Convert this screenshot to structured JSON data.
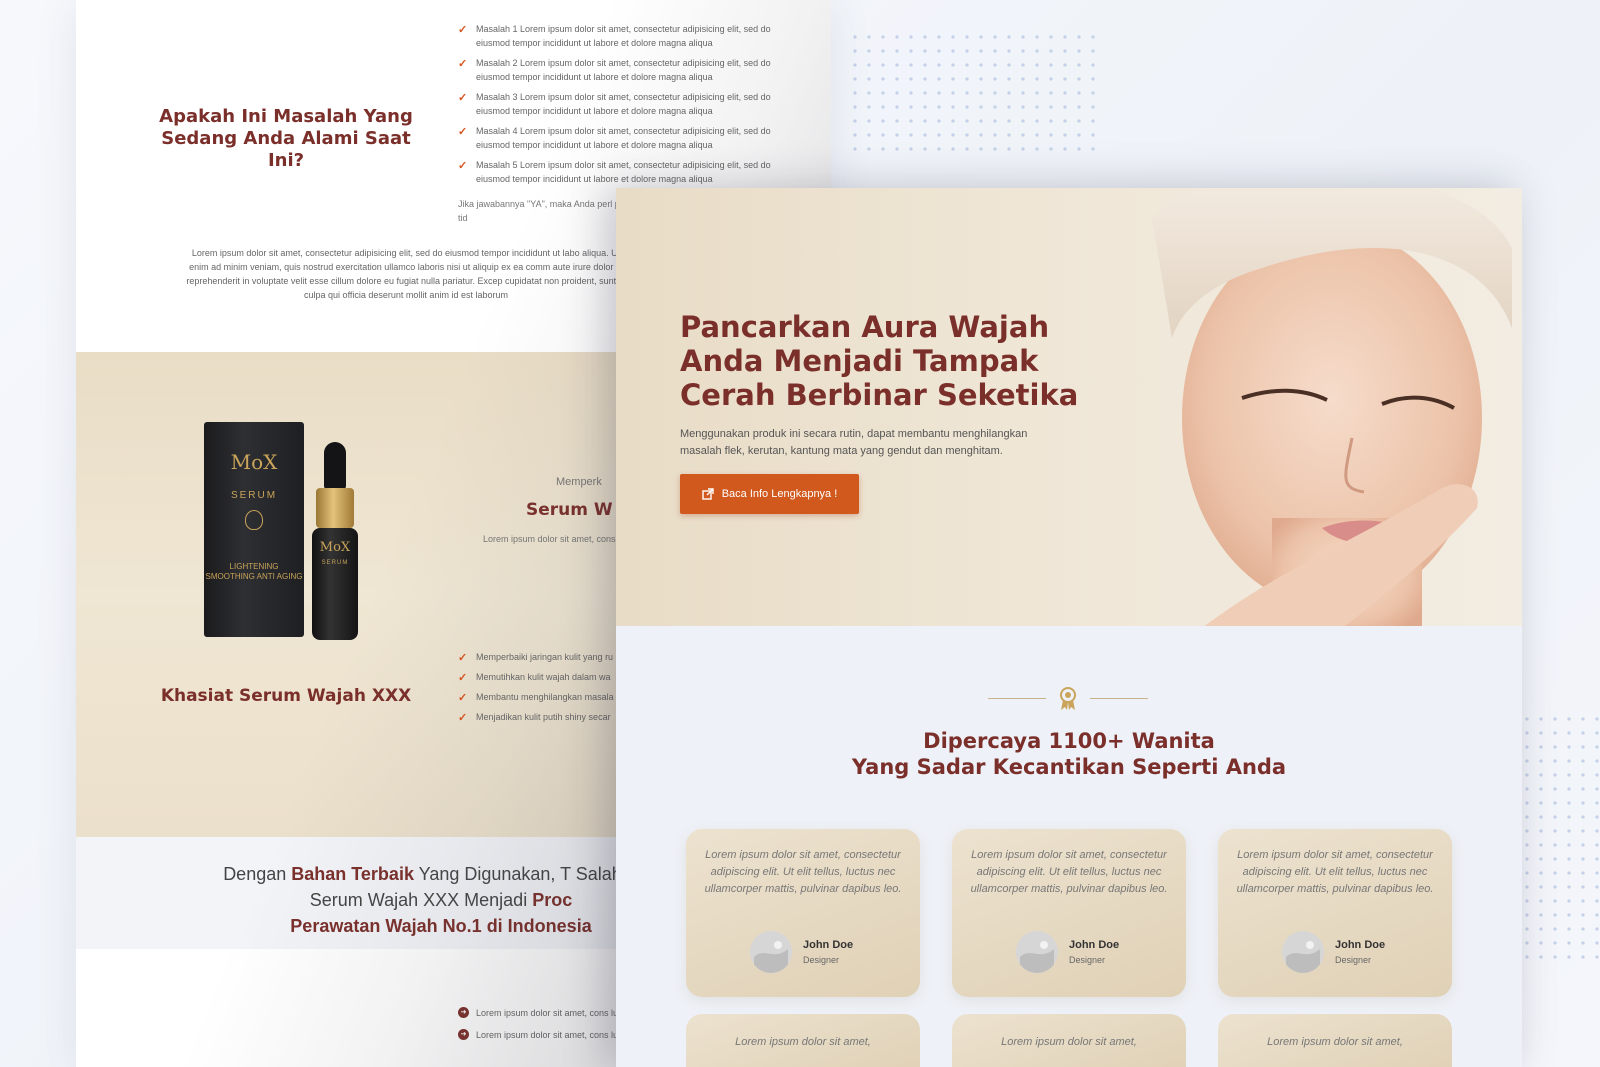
{
  "back": {
    "problem_title": "Apakah Ini Masalah Yang Sedang Anda Alami Saat Ini?",
    "problems": [
      "Masalah 1 Lorem ipsum dolor sit amet, consectetur adipisicing elit, sed do eiusmod tempor incididunt ut labore et dolore magna aliqua",
      "Masalah 2 Lorem ipsum dolor sit amet, consectetur adipisicing elit, sed do eiusmod tempor incididunt ut labore et dolore magna aliqua",
      "Masalah 3 Lorem ipsum dolor sit amet, consectetur adipisicing elit, sed do eiusmod tempor incididunt ut labore et dolore magna aliqua",
      "Masalah 4 Lorem ipsum dolor sit amet, consectetur adipisicing elit, sed do eiusmod tempor incididunt ut labore et dolore magna aliqua",
      "Masalah 5 Lorem ipsum dolor sit amet, consectetur adipisicing elit, sed do eiusmod tempor incididunt ut labore et dolore magna aliqua"
    ],
    "answer_text": "Jika jawabannya \"YA\", maka Anda perl pada halaman ini. Pelan-pelan saja, tid",
    "lorem_center": "Lorem ipsum dolor sit amet, consectetur adipisicing elit, sed do eiusmod tempor incididunt ut labo aliqua. Ut enim ad minim veniam, quis nostrud exercitation ullamco laboris nisi ut aliquip ex ea comm aute irure dolor in reprehenderit in voluptate velit esse cillum dolore eu fugiat nulla pariatur. Excep cupidatat non proident, sunt in culpa qui officia deserunt mollit anim id est laborum",
    "product": {
      "brand": "MoX",
      "sub": "SERUM",
      "box_tagline": "LIGHTENING SMOOTHING ANTI AGING"
    },
    "serum_subtitle": "Memperk",
    "serum_title": "Serum W",
    "serum_desc": "Lorem ipsum dolor sit amet, consecte nec ullamcorper matti",
    "khasiat_title": "Khasiat Serum Wajah XXX",
    "benefits": [
      "Memperbaiki jaringan kulit yang ru",
      "Memutihkan kulit wajah dalam wa",
      "Membantu menghilangkan masala gendut atau yang menghitam.",
      "Menjadikan kulit putih shiny secar"
    ],
    "bahan": {
      "part1": "Dengan ",
      "bold1": "Bahan Terbaik",
      "part2": " Yang Digunakan, T Salah Jika Serum Wajah XXX Menjadi ",
      "bold2": "Proc",
      "bold3": "Perawatan Wajah No.1 di Indonesia"
    },
    "bahan_items": [
      "Lorem ipsum dolor sit amet, cons luctus nec ullamcorper mattis, pul",
      "Lorem ipsum dolor sit amet, cons luctus nec ullamcorper mattis, pul"
    ]
  },
  "front": {
    "hero_title": "Pancarkan Aura Wajah Anda Menjadi Tampak Cerah Berbinar Seketika",
    "hero_sub": "Menggunakan produk ini secara rutin, dapat membantu menghilangkan masalah flek, kerutan, kantung mata yang gendut dan menghitam.",
    "cta_label": "Baca Info Lengkapnya !",
    "trust_line1": "Dipercaya 1100+ Wanita",
    "trust_line2": "Yang Sadar Kecantikan Seperti Anda",
    "testimonials": [
      {
        "quote": "Lorem ipsum dolor sit amet, consectetur adipiscing elit. Ut elit tellus, luctus nec ullamcorper mattis, pulvinar dapibus leo.",
        "name": "John Doe",
        "role": "Designer"
      },
      {
        "quote": "Lorem ipsum dolor sit amet, consectetur adipiscing elit. Ut elit tellus, luctus nec ullamcorper mattis, pulvinar dapibus leo.",
        "name": "John Doe",
        "role": "Designer"
      },
      {
        "quote": "Lorem ipsum dolor sit amet, consectetur adipiscing elit. Ut elit tellus, luctus nec ullamcorper mattis, pulvinar dapibus leo.",
        "name": "John Doe",
        "role": "Designer"
      }
    ],
    "next_row_quote": "Lorem ipsum dolor sit amet,"
  },
  "colors": {
    "accent": "#7b2f2a",
    "cta": "#d2591d",
    "beige": "#e8dcc6"
  },
  "icons": [
    "check-icon",
    "external-link-icon",
    "award-icon",
    "arrow-circle-icon",
    "avatar"
  ]
}
